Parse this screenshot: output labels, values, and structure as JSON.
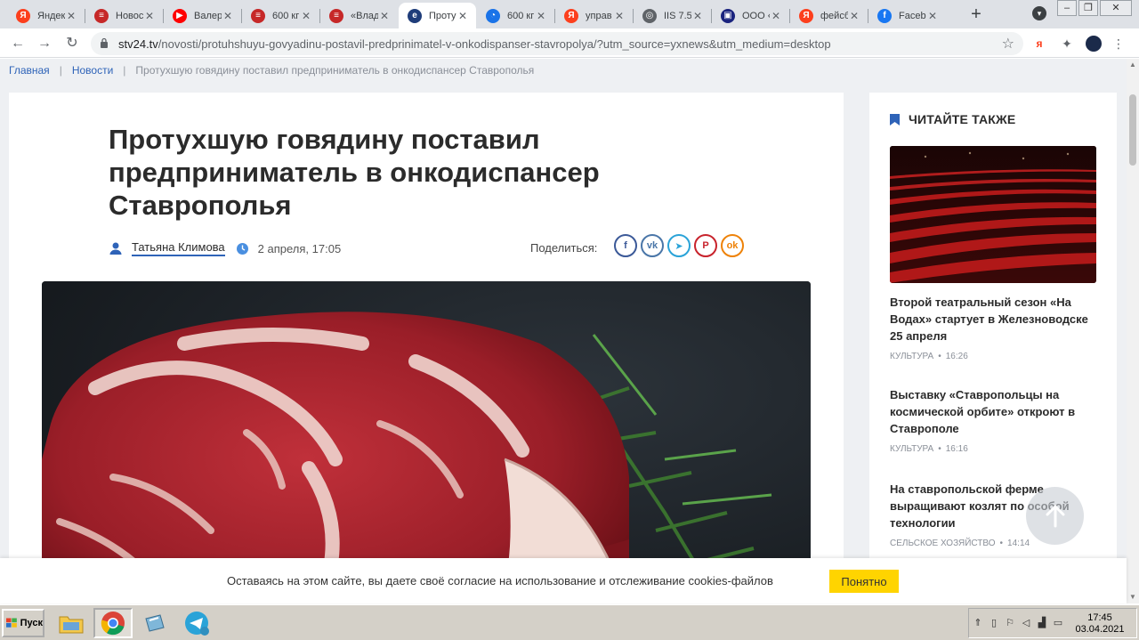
{
  "browser": {
    "tabs": [
      {
        "label": "Яндекс",
        "icon": "yandex-icon",
        "color": "#fc3f1d",
        "glyph": "Я"
      },
      {
        "label": "Новост",
        "icon": "news-icon",
        "color": "#c62828",
        "glyph": "≡"
      },
      {
        "label": "Валер",
        "icon": "youtube-icon",
        "color": "#ff0000",
        "glyph": "▶"
      },
      {
        "label": "600 кг",
        "icon": "news-icon",
        "color": "#c62828",
        "glyph": "≡"
      },
      {
        "label": "«Влад",
        "icon": "news-icon",
        "color": "#c62828",
        "glyph": "≡"
      },
      {
        "label": "Проту",
        "icon": "stv24-icon",
        "color": "#1f3d7a",
        "glyph": "e",
        "active": true
      },
      {
        "label": "600 кг",
        "icon": "site-icon",
        "color": "#1a73e8",
        "glyph": "◔"
      },
      {
        "label": "управ",
        "icon": "yandex-icon",
        "color": "#fc3f1d",
        "glyph": "Я"
      },
      {
        "label": "IIS 7.5",
        "icon": "globe-icon",
        "color": "#5f6368",
        "glyph": "◎"
      },
      {
        "label": "ООО «",
        "icon": "company-icon",
        "color": "#1a237e",
        "glyph": "▣"
      },
      {
        "label": "фейсб",
        "icon": "yandex-icon",
        "color": "#fc3f1d",
        "glyph": "Я"
      },
      {
        "label": "Faceb",
        "icon": "facebook-icon",
        "color": "#1877f2",
        "glyph": "f"
      }
    ],
    "url_host": "stv24.tv",
    "url_path": "/novosti/protuhshuyu-govyadinu-postavil-predprinimatel-v-onkodispanser-stavropolya/?utm_source=yxnews&utm_medium=desktop"
  },
  "breadcrumb": {
    "home": "Главная",
    "news": "Новости",
    "current": "Протухшую говядину поставил предприниматель в онкодиспансер Ставрополья"
  },
  "article": {
    "title": "Протухшую говядину поставил предприниматель в онкодиспансер Ставрополья",
    "author": "Татьяна Климова",
    "date": "2 апреля, 17:05",
    "share_label": "Поделиться:"
  },
  "share_buttons": [
    {
      "icon": "facebook-icon",
      "glyph": "f",
      "color": "#3b5998"
    },
    {
      "icon": "vk-icon",
      "glyph": "vk",
      "color": "#4a76a8"
    },
    {
      "icon": "telegram-icon",
      "glyph": "➤",
      "color": "#2aa3d8"
    },
    {
      "icon": "pinterest-icon",
      "glyph": "P",
      "color": "#c8232c"
    },
    {
      "icon": "odnoklassniki-icon",
      "glyph": "ok",
      "color": "#ee8208"
    }
  ],
  "sidebar": {
    "heading": "ЧИТАЙТЕ ТАКЖЕ",
    "items": [
      {
        "title": "Второй театральный сезон «На Водах» стартует в Железноводске 25 апреля",
        "category": "КУЛЬТУРА",
        "time": "16:26"
      },
      {
        "title": "Выставку «Ставропольцы на космической орбите» откроют в Ставрополе",
        "category": "КУЛЬТУРА",
        "time": "16:16"
      },
      {
        "title": "На ставропольской ферме выращивают козлят по особой технологии",
        "category": "СЕЛЬСКОЕ ХОЗЯЙСТВО",
        "time": "14:14"
      }
    ]
  },
  "cookie": {
    "text": "Оставаясь на этом сайте, вы даете своё согласие на использование и отслеживание cookies-файлов",
    "button": "Понятно"
  },
  "taskbar": {
    "start_label": "Пуск",
    "time": "17:45",
    "date": "03.04.2021"
  },
  "colors": {
    "accent": "#2e63b8",
    "cookie_button": "#ffd400"
  }
}
